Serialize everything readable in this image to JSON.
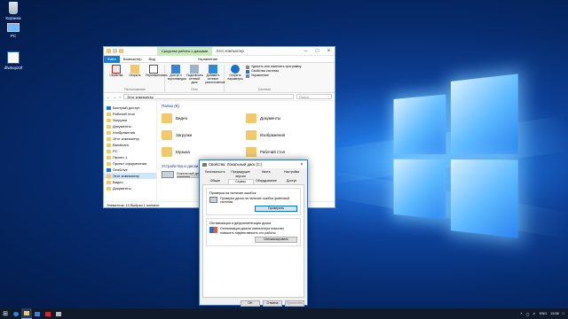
{
  "desktop": {
    "icons": [
      {
        "label": "Корзина",
        "icon": "recycle-bin-icon"
      },
      {
        "label": "PC",
        "icon": "computer-icon"
      },
      {
        "label": "dfwkop22f",
        "icon": "shortcut-icon"
      }
    ]
  },
  "explorer": {
    "context_tab": "Средства работы с дисками",
    "title": "Этот компьютер",
    "tabs": [
      "Файл",
      "Компьютер",
      "Вид"
    ],
    "manage_tab": "Управление",
    "ribbon": {
      "location_group": "Расположение",
      "network_group": "Сеть",
      "system_group": "Система",
      "items": [
        {
          "label": "Свойства",
          "icon": "properties-icon"
        },
        {
          "label": "Открыть",
          "icon": "open-icon"
        },
        {
          "label": "Переименовать",
          "icon": "rename-icon"
        },
        {
          "label": "Доступ к мультимедиа",
          "icon": "media-icon"
        },
        {
          "label": "Подключить сетевой диск",
          "icon": "map-drive-icon"
        },
        {
          "label": "Добавить сетевое расположение",
          "icon": "network-location-icon"
        },
        {
          "label": "Открыть параметры",
          "icon": "settings-icon"
        }
      ],
      "system_items": [
        {
          "label": "Удалить или изменить программу",
          "icon": "uninstall-icon"
        },
        {
          "label": "Свойства системы",
          "icon": "system-properties-icon"
        },
        {
          "label": "Управление",
          "icon": "manage-icon"
        }
      ]
    },
    "address": "Этот компьютер",
    "search_placeholder": "Поиск",
    "nav": [
      {
        "label": "Быстрый доступ",
        "sel": false
      },
      {
        "label": "Рабочий стол",
        "sel": false
      },
      {
        "label": "Загрузки",
        "sel": false
      },
      {
        "label": "Документы",
        "sel": false
      },
      {
        "label": "Изображения",
        "sel": false
      },
      {
        "label": "Этот компьютер",
        "sel": false
      },
      {
        "label": "Bandicam",
        "sel": false
      },
      {
        "label": "PC",
        "sel": false
      },
      {
        "label": "Проект 1",
        "sel": false
      },
      {
        "label": "Проект оформления",
        "sel": false
      },
      {
        "label": "OneDrive",
        "sel": false
      },
      {
        "label": "Этот компьютер",
        "sel": true
      },
      {
        "label": "Видео",
        "sel": false
      },
      {
        "label": "Документы",
        "sel": false
      }
    ],
    "folders_heading": "Папки (6)",
    "folders": [
      "Видео",
      "Документы",
      "Загрузки",
      "Изображения",
      "Музыка",
      "Рабочий стол"
    ],
    "devices_heading": "Устройства и диски",
    "drive_label": "Локальный диск",
    "status": "Элементов: 10   Выбран 1 элемент"
  },
  "props": {
    "title": "Свойства: Локальный диск (C:)",
    "tabs_row1": [
      "Безопасность",
      "Предыдущие версии",
      "Квота",
      "Настройка"
    ],
    "tabs_row2": [
      "Общие",
      "Сервис",
      "Оборудование",
      "Доступ"
    ],
    "check_group": "Проверка на наличие ошибок",
    "check_text": "Проверка диска на наличие ошибок файловой системы.",
    "check_button": "Проверить",
    "opt_group": "Оптимизация и дефрагментация диска",
    "opt_text": "Оптимизация дисков компьютера помогает повысить эффективность его работы.",
    "opt_button": "Оптимизировать",
    "ok": "OK",
    "cancel": "Отмена",
    "apply": "Применить"
  },
  "taskbar": {
    "lang": "ENG",
    "time": "13:58"
  },
  "colors": {
    "accent": "#0078d7",
    "file_tab": "#1979ca",
    "folder": "#f1c96c"
  }
}
